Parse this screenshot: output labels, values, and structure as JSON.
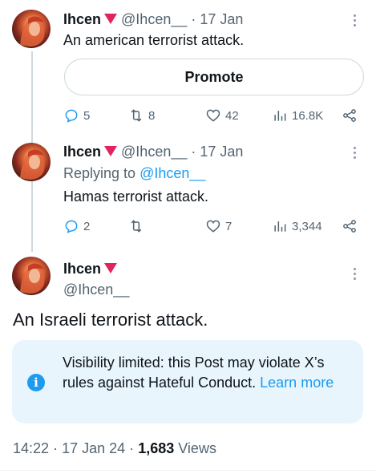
{
  "tweets": [
    {
      "name": "Ihcen",
      "handle": "@Ihcen__",
      "dot": "·",
      "date": "17 Jan",
      "text": "An american terrorist attack.",
      "promote_label": "Promote",
      "replies": "5",
      "retweets": "8",
      "likes": "42",
      "views": "16.8K"
    },
    {
      "name": "Ihcen",
      "handle": "@Ihcen__",
      "dot": "·",
      "date": "17 Jan",
      "replying_prefix": "Replying to",
      "replying_handle": "@Ihcen__",
      "text": "Hamas terrorist attack.",
      "replies": "2",
      "retweets": "",
      "likes": "7",
      "views": "3,344"
    }
  ],
  "main_tweet": {
    "name": "Ihcen",
    "handle": "@Ihcen__",
    "text": "An Israeli terrorist attack.",
    "notice": {
      "icon": "info-icon",
      "text": "Visibility limited: this Post may violate X’s rules against Hateful Conduct.",
      "link": "Learn more"
    },
    "time": "14:22",
    "sep1": "·",
    "date": "17 Jan 24",
    "sep2": "·",
    "views_count": "1,683",
    "views_label": "Views"
  },
  "colors": {
    "accent": "#1d9bf0",
    "muted": "#536471",
    "badge": "#e0245e",
    "notice_bg": "#e8f5fd"
  }
}
